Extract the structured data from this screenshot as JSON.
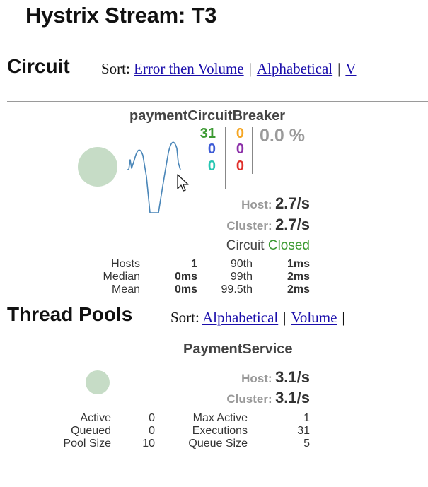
{
  "page": {
    "title": "Hystrix Stream: T3"
  },
  "circuit_section": {
    "title": "Circuit",
    "sort_label": "Sort:",
    "sort_options": [
      "Error then Volume",
      "Alphabetical",
      "V"
    ],
    "separator": "|"
  },
  "circuit": {
    "name": "paymentCircuitBreaker",
    "counts": {
      "success": "31",
      "short_circuited": "0",
      "bad_request": "0",
      "timeout": "0",
      "rejected": "0",
      "failure": "0"
    },
    "error_percentage": "0.0 %",
    "host_label": "Host:",
    "host_rate": "2.7/s",
    "cluster_label": "Cluster:",
    "cluster_rate": "2.7/s",
    "status_label": "Circuit",
    "status_value": "Closed",
    "stats": {
      "hosts_label": "Hosts",
      "hosts": "1",
      "median_label": "Median",
      "median": "0ms",
      "mean_label": "Mean",
      "mean": "0ms",
      "p90_label": "90th",
      "p90": "1ms",
      "p99_label": "99th",
      "p99": "2ms",
      "p995_label": "99.5th",
      "p995": "2ms"
    },
    "colors": {
      "success": "#3c9a32",
      "short_circuited": "#3d5bd6",
      "bad_request": "#26c6b2",
      "timeout": "#f5a623",
      "rejected": "#8b2fa8",
      "failure": "#e0302b",
      "health_circle": "#c6dcc6",
      "sparkline": "#4a86b8"
    }
  },
  "thread_pools_section": {
    "title": "Thread Pools",
    "sort_label": "Sort:",
    "sort_options": [
      "Alphabetical",
      "Volume"
    ],
    "separator": "|"
  },
  "thread_pool": {
    "name": "PaymentService",
    "host_label": "Host:",
    "host_rate": "3.1/s",
    "cluster_label": "Cluster:",
    "cluster_rate": "3.1/s",
    "stats": {
      "active_label": "Active",
      "active": "0",
      "queued_label": "Queued",
      "queued": "0",
      "pool_size_label": "Pool Size",
      "pool_size": "10",
      "max_active_label": "Max Active",
      "max_active": "1",
      "executions_label": "Executions",
      "executions": "31",
      "queue_size_label": "Queue Size",
      "queue_size": "5"
    }
  },
  "icons": {
    "cursor": "mouse-pointer-icon"
  }
}
